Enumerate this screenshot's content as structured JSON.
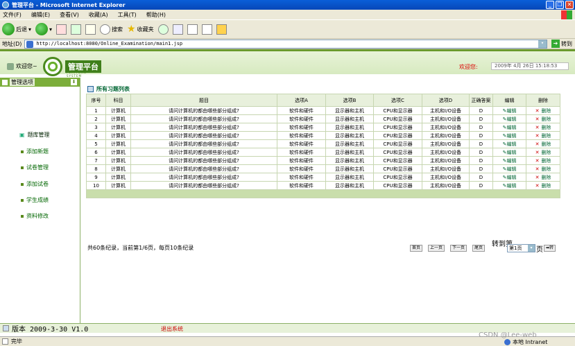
{
  "window": {
    "title": "管理平台 - Microsoft Internet Explorer"
  },
  "menu": [
    "文件(F)",
    "编辑(E)",
    "查看(V)",
    "收藏(A)",
    "工具(T)",
    "帮助(H)"
  ],
  "toolbar": {
    "back": "后退",
    "search": "搜索",
    "favorites": "收藏夹"
  },
  "address": {
    "label": "地址(D)",
    "url": "http://localhost:8080/Online_Examination/main1.jsp",
    "go": "转到"
  },
  "header": {
    "welcome_left": "欢迎您~",
    "logo_title": "管理平台",
    "logo_sub": "PLATFORM SYSTEM",
    "welcome_right": "欢迎您:",
    "datetime": "2009年 4月 26日 15:18:53"
  },
  "sidebar": {
    "title": "管理选项",
    "items": [
      "题库管理",
      "添加新题",
      "试卷管理",
      "添加试卷",
      "学生成绩",
      "资料修改"
    ]
  },
  "panel": {
    "title": "所有习题列表"
  },
  "table": {
    "headers": [
      "序号",
      "科目",
      "题目",
      "选项A",
      "选项B",
      "选项C",
      "选项D",
      "正确答案",
      "编辑",
      "删除"
    ],
    "rows": [
      [
        "1",
        "计算机",
        "请问计算机的都由哪些部分组成?",
        "软件和硬件",
        "显示器和主机",
        "CPU和显示器",
        "主机和I/O设备",
        "D",
        "编辑",
        "删除"
      ],
      [
        "2",
        "计算机",
        "请问计算机的都由哪些部分组成?",
        "软件和硬件",
        "显示器和主机",
        "CPU和显示器",
        "主机和I/O设备",
        "D",
        "编辑",
        "删除"
      ],
      [
        "3",
        "计算机",
        "请问计算机的都由哪些部分组成?",
        "软件和硬件",
        "显示器和主机",
        "CPU和显示器",
        "主机和I/O设备",
        "D",
        "编辑",
        "删除"
      ],
      [
        "4",
        "计算机",
        "请问计算机的都由哪些部分组成?",
        "软件和硬件",
        "显示器和主机",
        "CPU和显示器",
        "主机和I/O设备",
        "D",
        "编辑",
        "删除"
      ],
      [
        "5",
        "计算机",
        "请问计算机的都由哪些部分组成?",
        "软件和硬件",
        "显示器和主机",
        "CPU和显示器",
        "主机和I/O设备",
        "D",
        "编辑",
        "删除"
      ],
      [
        "6",
        "计算机",
        "请问计算机的都由哪些部分组成?",
        "软件和硬件",
        "显示器和主机",
        "CPU和显示器",
        "主机和I/O设备",
        "D",
        "编辑",
        "删除"
      ],
      [
        "7",
        "计算机",
        "请问计算机的都由哪些部分组成?",
        "软件和硬件",
        "显示器和主机",
        "CPU和显示器",
        "主机和I/O设备",
        "D",
        "编辑",
        "删除"
      ],
      [
        "8",
        "计算机",
        "请问计算机的都由哪些部分组成?",
        "软件和硬件",
        "显示器和主机",
        "CPU和显示器",
        "主机和I/O设备",
        "D",
        "编辑",
        "删除"
      ],
      [
        "9",
        "计算机",
        "请问计算机的都由哪些部分组成?",
        "软件和硬件",
        "显示器和主机",
        "CPU和显示器",
        "主机和I/O设备",
        "D",
        "编辑",
        "删除"
      ],
      [
        "10",
        "计算机",
        "请问计算机的都由哪些部分组成?",
        "软件和硬件",
        "显示器和主机",
        "CPU和显示器",
        "主机和I/O设备",
        "D",
        "编辑",
        "删除"
      ]
    ]
  },
  "pager": {
    "summary": "共60条纪录，当前第1/6页，每页10条纪录",
    "first": "首页",
    "prev": "上一页",
    "next": "下一页",
    "last": "尾页",
    "goto_label": "转到第",
    "selected_page": "第1页",
    "page_unit": "页",
    "goto_button": "转"
  },
  "footer": {
    "version": "版本 2009-3-30 V1.0",
    "logout": "退出系统"
  },
  "statusbar": {
    "status": "完毕",
    "zone": "本地 Intranet"
  },
  "watermark": "CSDN @Lee-web"
}
